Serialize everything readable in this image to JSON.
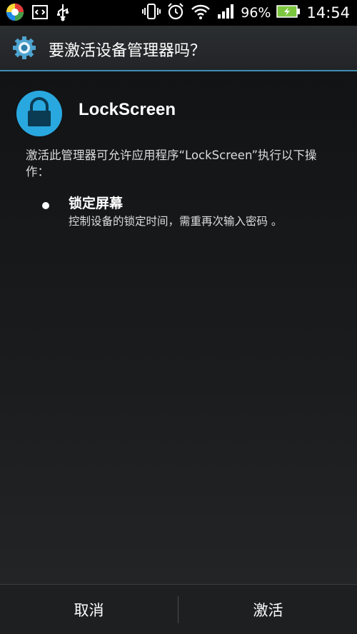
{
  "status_bar": {
    "icons_left": [
      "app-colorful-icon",
      "code-box-icon",
      "usb-icon"
    ],
    "icons_right": [
      "vibrate-icon",
      "alarm-clock-icon",
      "wifi-icon",
      "signal-bars-icon",
      "battery-charging-icon"
    ],
    "battery": "96%",
    "time": "14:54"
  },
  "dialog": {
    "title": "要激活设备管理器吗？",
    "app_name": "LockScreen",
    "description": "激活此管理器可允许应用程序“LockScreen”执行以下操作：",
    "policies": [
      {
        "title": "锁定屏幕",
        "description": "控制设备的锁定时间，需重再次输入密码 。"
      }
    ],
    "buttons": {
      "cancel": "取消",
      "activate": "激活"
    }
  },
  "colors": {
    "accent": "#3f8fb2",
    "app_icon": "#29a8df",
    "battery": "#7bc53f"
  }
}
